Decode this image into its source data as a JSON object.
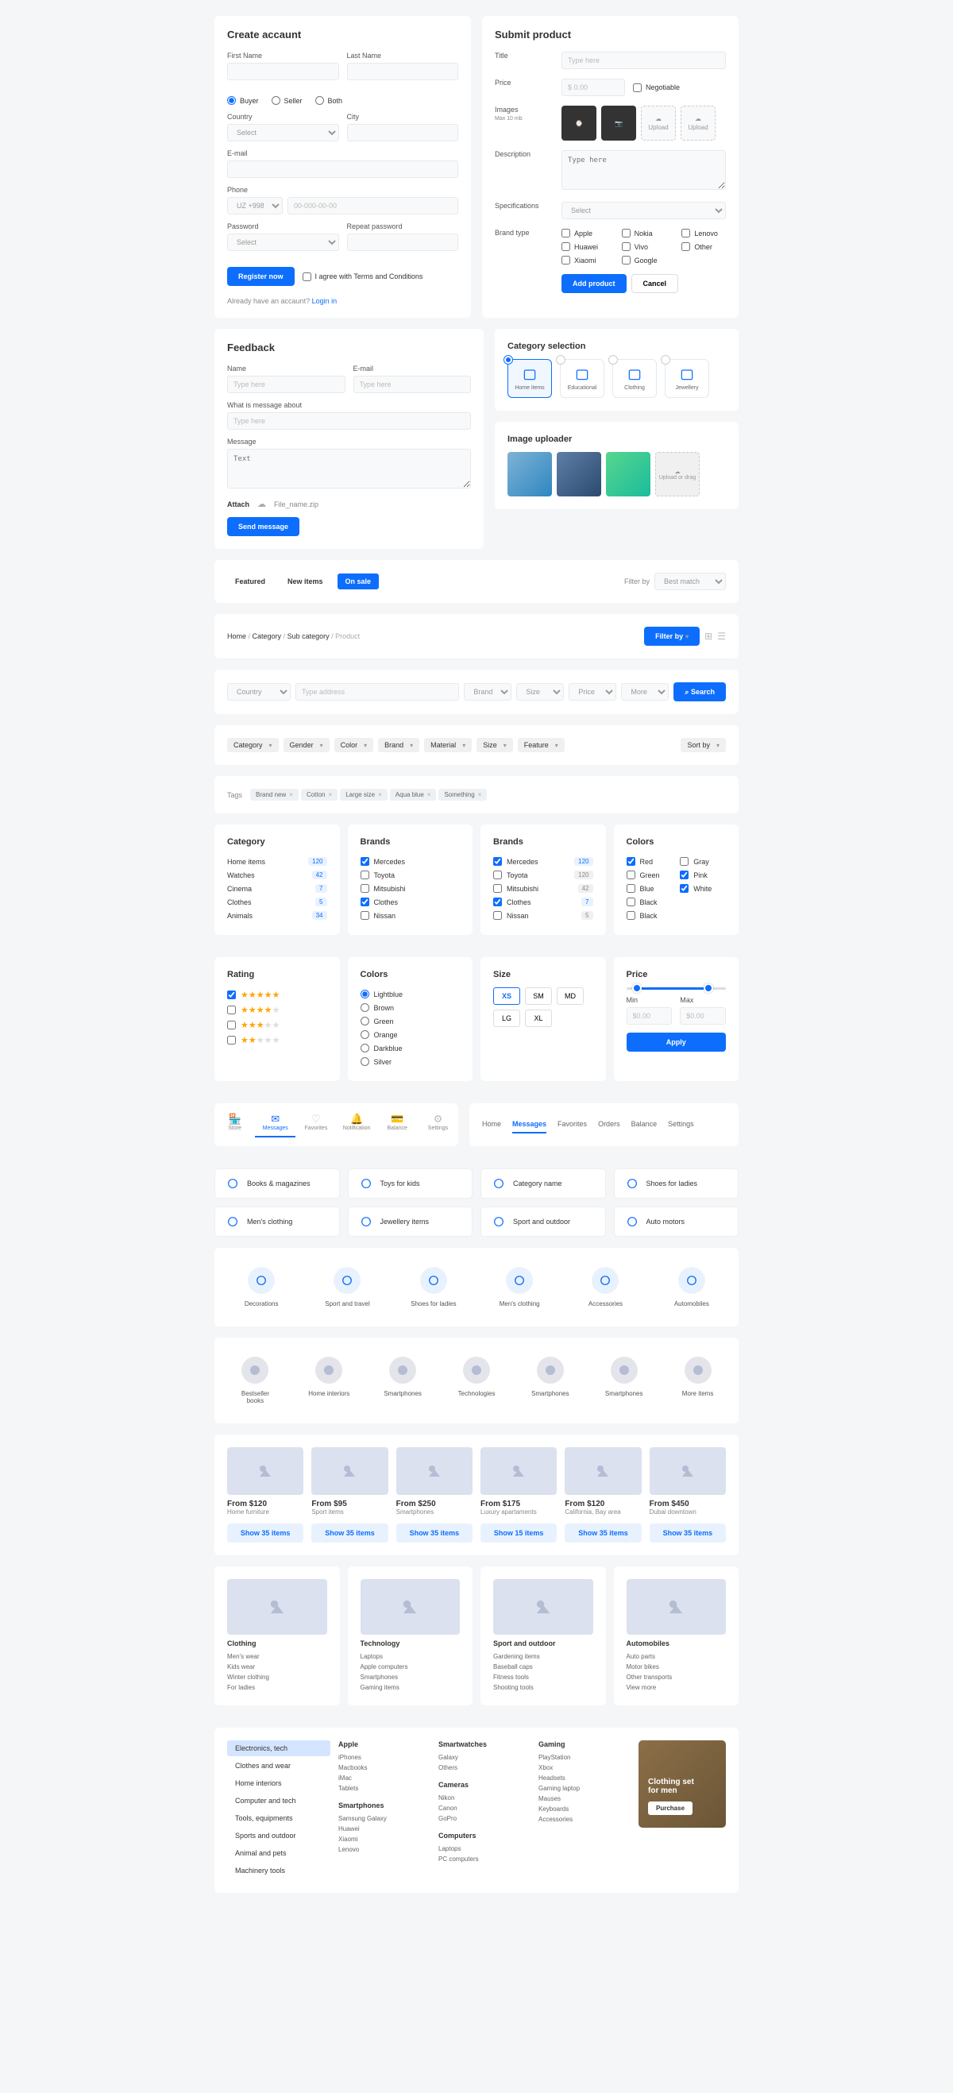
{
  "account": {
    "title": "Create accaunt",
    "firstName": "First Name",
    "lastName": "Last Name",
    "roles": [
      "Buyer",
      "Seller",
      "Both"
    ],
    "country": "Country",
    "countryPh": "Select",
    "city": "City",
    "email": "E-mail",
    "phone": "Phone",
    "phonePrefix": "UZ +998",
    "phonePh": "00-000-00-00",
    "password": "Password",
    "passwordPh": "Select",
    "repeat": "Repeat password",
    "registerBtn": "Register now",
    "agree": "I agree with Terms and Conditions",
    "already": "Already have an accaunt?",
    "login": "Login in"
  },
  "submit": {
    "title": "Submit product",
    "titleLbl": "Title",
    "titlePh": "Type here",
    "priceLbl": "Price",
    "pricePh": "$ 0.00",
    "negotiable": "Negotiable",
    "imagesLbl": "Images",
    "imagesHint": "Max 10 mb",
    "upload": "Upload",
    "descLbl": "Description",
    "descPh": "Type here",
    "specLbl": "Specifications",
    "specPh": "Select",
    "brandLbl": "Brand type",
    "brands": [
      "Apple",
      "Nokia",
      "Lenovo",
      "Huawei",
      "Vivo",
      "Other",
      "Xiaomi",
      "Google"
    ],
    "addBtn": "Add product",
    "cancelBtn": "Cancel"
  },
  "feedback": {
    "title": "Feedback",
    "name": "Name",
    "namePh": "Type here",
    "email": "E-mail",
    "emailPh": "Type here",
    "subject": "What is message about",
    "subjectPh": "Type here",
    "message": "Message",
    "messagePh": "Text",
    "attach": "Attach",
    "filename": "File_name.zip",
    "sendBtn": "Send message"
  },
  "catSel": {
    "title": "Category selection",
    "items": [
      "Home items",
      "Educational",
      "Clothing",
      "Jewellery"
    ]
  },
  "imgUp": {
    "title": "Image uploader",
    "hint": "Upload or drag"
  },
  "tabs": {
    "items": [
      "Featured",
      "New items",
      "On sale"
    ],
    "filterBy": "Filter by",
    "bestMatch": "Best match"
  },
  "crumbs": {
    "home": "Home",
    "cat": "Category",
    "sub": "Sub category",
    "prod": "Product",
    "filterBtn": "Filter by",
    "grid": "grid",
    "list": "list"
  },
  "search": {
    "country": "Country",
    "address": "Type address",
    "brand": "Brand",
    "size": "Size",
    "price": "Price",
    "more": "More",
    "btn": "Search"
  },
  "filters": {
    "items": [
      "Category",
      "Gender",
      "Color",
      "Brand",
      "Material",
      "Size",
      "Feature"
    ],
    "sortBy": "Sort by"
  },
  "tags": {
    "label": "Tags",
    "items": [
      "Brand new",
      "Cotton",
      "Large size",
      "Aqua blue",
      "Something"
    ]
  },
  "catList": {
    "title": "Category",
    "items": [
      {
        "n": "Home items",
        "c": "120"
      },
      {
        "n": "Watches",
        "c": "42"
      },
      {
        "n": "Cinema",
        "c": "7"
      },
      {
        "n": "Clothes",
        "c": "5"
      },
      {
        "n": "Animals",
        "c": "34"
      }
    ]
  },
  "brands1": {
    "title": "Brands",
    "items": [
      {
        "n": "Mercedes",
        "chk": true
      },
      {
        "n": "Toyota"
      },
      {
        "n": "Mitsubishi"
      },
      {
        "n": "Clothes",
        "chk": true
      },
      {
        "n": "Nissan"
      }
    ]
  },
  "brands2": {
    "title": "Brands",
    "items": [
      {
        "n": "Mercedes",
        "c": "120",
        "chk": true
      },
      {
        "n": "Toyota",
        "c": "120"
      },
      {
        "n": "Mitsubishi",
        "c": "42"
      },
      {
        "n": "Clothes",
        "c": "7",
        "chk": true
      },
      {
        "n": "Nissan",
        "c": "5"
      }
    ]
  },
  "colors1": {
    "title": "Colors",
    "left": [
      {
        "n": "Red",
        "chk": true
      },
      {
        "n": "Green"
      },
      {
        "n": "Blue"
      },
      {
        "n": "Black"
      },
      {
        "n": "Black"
      }
    ],
    "right": [
      {
        "n": "Gray"
      },
      {
        "n": "Pink",
        "chk": true
      },
      {
        "n": "White",
        "chk": true
      }
    ]
  },
  "rating": {
    "title": "Rating",
    "levels": [
      5,
      4,
      3,
      2
    ]
  },
  "colorsRadio": {
    "title": "Colors",
    "items": [
      "Lightblue",
      "Brown",
      "Green",
      "Orange",
      "Darkblue",
      "Silver"
    ]
  },
  "sizes": {
    "title": "Size",
    "items": [
      "XS",
      "SM",
      "MD",
      "LG",
      "XL"
    ]
  },
  "priceF": {
    "title": "Price",
    "min": "Min",
    "max": "Max",
    "ph": "$0.00",
    "apply": "Apply"
  },
  "navIcons": {
    "items": [
      "Store",
      "Messages",
      "Favorites",
      "Notification",
      "Balance",
      "Settings"
    ]
  },
  "navText": {
    "items": [
      "Home",
      "Messages",
      "Favorites",
      "Orders",
      "Balance",
      "Settings"
    ]
  },
  "catsH": {
    "items": [
      "Books & magazines",
      "Toys for kids",
      "Category name",
      "Shoes for ladies",
      "Men's clothing",
      "Jewellery items",
      "Sport and outdoor",
      "Auto motors"
    ]
  },
  "catsV1": {
    "items": [
      "Decorations",
      "Sport and travel",
      "Shoes for ladies",
      "Men's clothing",
      "Accessories",
      "Automobiles"
    ]
  },
  "catsV2": {
    "items": [
      "Bestseller books",
      "Home interiors",
      "Smartphones",
      "Technologies",
      "Smartphones",
      "Smartphones",
      "More items"
    ]
  },
  "prods": [
    {
      "p": "From $120",
      "s": "Home furniture",
      "b": "Show 35 items"
    },
    {
      "p": "From $95",
      "s": "Sport items",
      "b": "Show 35 items"
    },
    {
      "p": "From $250",
      "s": "Smartphones",
      "b": "Show 35 items"
    },
    {
      "p": "From $175",
      "s": "Luxury apartaments",
      "b": "Show 15 items"
    },
    {
      "p": "From $120",
      "s": "California, Bay area",
      "b": "Show 35 items"
    },
    {
      "p": "From $450",
      "s": "Dubai downtown",
      "b": "Show 35 items"
    }
  ],
  "bigCats": [
    {
      "t": "Clothing",
      "items": [
        "Men's wear",
        "Kids wear",
        "Winter clothing",
        "For ladies"
      ]
    },
    {
      "t": "Technology",
      "items": [
        "Laptops",
        "Apple computers",
        "Smartphones",
        "Gaming items"
      ]
    },
    {
      "t": "Sport and outdoor",
      "items": [
        "Gardening items",
        "Baseball caps",
        "Fitness tools",
        "Shooting tools"
      ]
    },
    {
      "t": "Automobiles",
      "items": [
        "Auto parts",
        "Motor bikes",
        "Other transports",
        "View more"
      ]
    }
  ],
  "sideMenu": {
    "items": [
      "Electronics, tech",
      "Clothes and wear",
      "Home interiors",
      "Computer and tech",
      "Tools, equipments",
      "Sports and outdoor",
      "Animal and pets",
      "Machinery tools"
    ]
  },
  "mega": [
    {
      "t": "Apple",
      "items": [
        "iPhones",
        "Macbooks",
        "iMac",
        "Tablets"
      ]
    },
    {
      "t2": "Smartphones",
      "items2": [
        "Samsung Galaxy",
        "Huawei",
        "Xiaomi",
        "Lenovo"
      ]
    },
    {
      "t": "Smartwatches",
      "items": [
        "Galaxy",
        "Others"
      ]
    },
    {
      "t2": "Cameras",
      "items2": [
        "Nikon",
        "Canon",
        "GoPro"
      ]
    },
    {
      "t3": "Computers",
      "items3": [
        "Laptops",
        "PC computers"
      ]
    },
    {
      "t": "Gaming",
      "items": [
        "PlayStation",
        "Xbox",
        "Headsets",
        "Gaming laptop",
        "Mauses",
        "Keyboards",
        "Accessories"
      ]
    }
  ],
  "promo": {
    "title": "Clothing set\nfor men",
    "btn": "Purchase"
  }
}
